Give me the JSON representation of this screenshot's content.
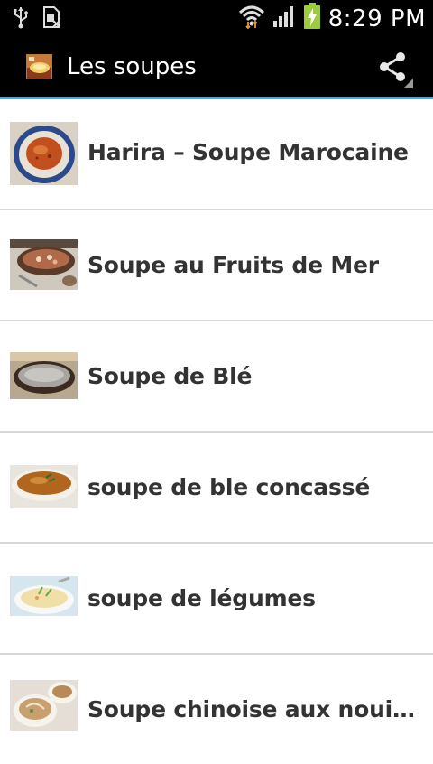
{
  "status_bar": {
    "time": "8:29 PM",
    "icons": [
      "usb-icon",
      "sim-icon",
      "wifi-icon",
      "signal-icon",
      "battery-charging-icon"
    ]
  },
  "action_bar": {
    "title": "Les soupes",
    "share_icon": "share-icon",
    "accent_color": "#33b5e5"
  },
  "recipes": [
    {
      "title": "Harira – Soupe Marocaine"
    },
    {
      "title": "Soupe au Fruits de Mer"
    },
    {
      "title": "Soupe de Blé"
    },
    {
      "title": "soupe de ble concassé"
    },
    {
      "title": "soupe de légumes"
    },
    {
      "title": "Soupe chinoise aux nouilles et aux légumes"
    }
  ]
}
